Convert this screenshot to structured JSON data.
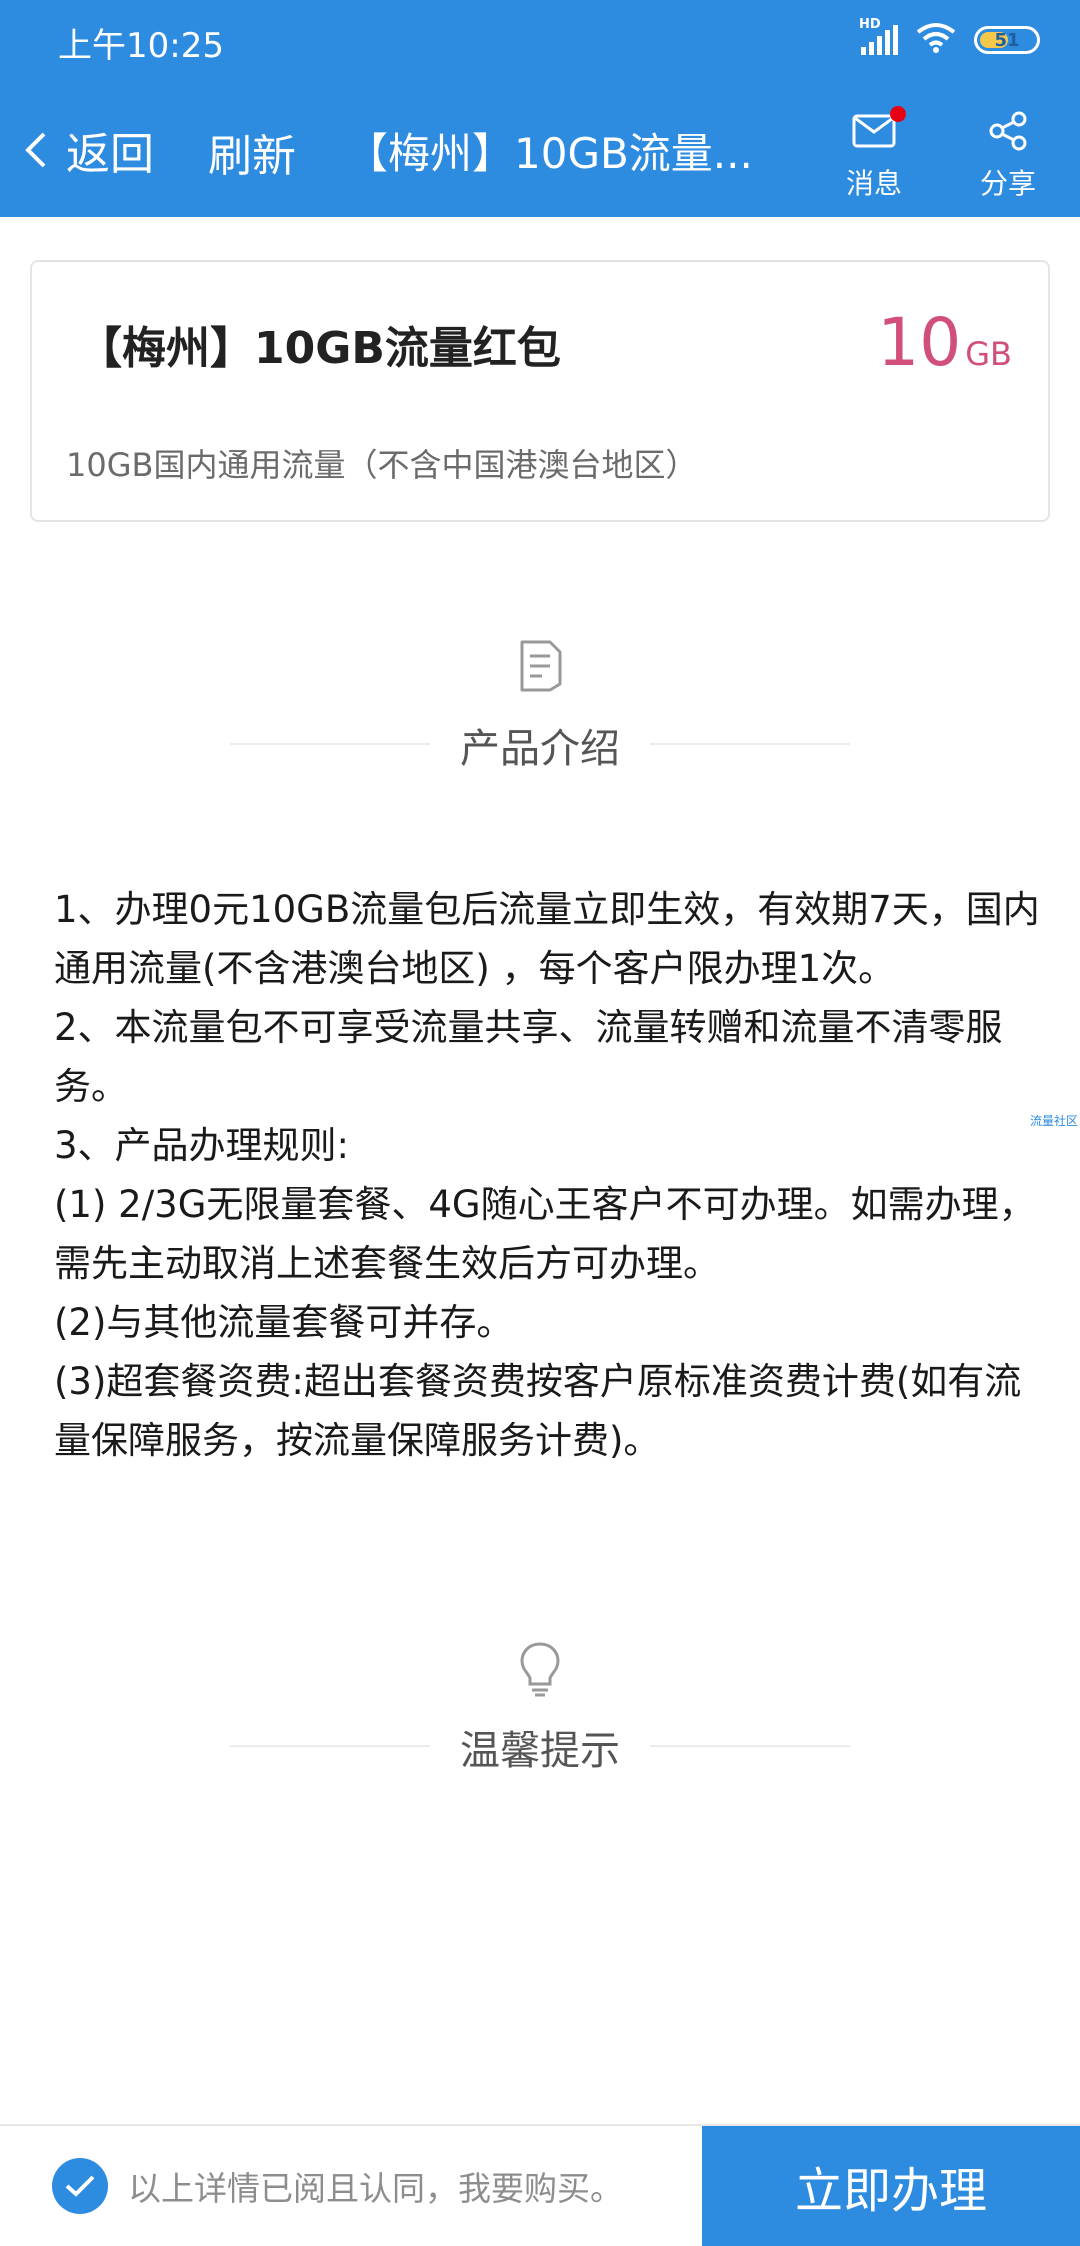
{
  "status_bar": {
    "time": "上午10:25",
    "signal_label": "HD",
    "battery": "51"
  },
  "nav": {
    "back_label": "返回",
    "refresh_label": "刷新",
    "title": "【梅州】10GB流量...",
    "message_label": "消息",
    "share_label": "分享"
  },
  "product": {
    "title": "【梅州】10GB流量红包",
    "amount": "10",
    "unit": "GB",
    "desc": "10GB国内通用流量（不含中国港澳台地区）"
  },
  "intro_section": {
    "label": "产品介绍"
  },
  "intro_lines": [
    "1、办理0元10GB流量包后流量立即生效，有效期7天，国内通用流量(不含港澳台地区) ，每个客户限办理1次。",
    "2、本流量包不可享受流量共享、流量转赠和流量不清零服务。",
    "3、产品办理规则:",
    "(1) 2/3G无限量套餐、4G随心王客户不可办理。如需办理，需先主动取消上述套餐生效后方可办理。",
    "(2)与其他流量套餐可并存。",
    "(3)超套餐资费:超出套餐资费按客户原标准资费计费(如有流量保障服务，按流量保障服务计费)。"
  ],
  "tips_section": {
    "label": "温馨提示"
  },
  "side_tag": "流量社区",
  "bottom": {
    "agree_text": "以上详情已阅且认同，我要购买。",
    "apply_label": "立即办理"
  },
  "colors": {
    "primary": "#2d8be0",
    "amount": "#d05079",
    "badge_dot": "#e60012"
  }
}
